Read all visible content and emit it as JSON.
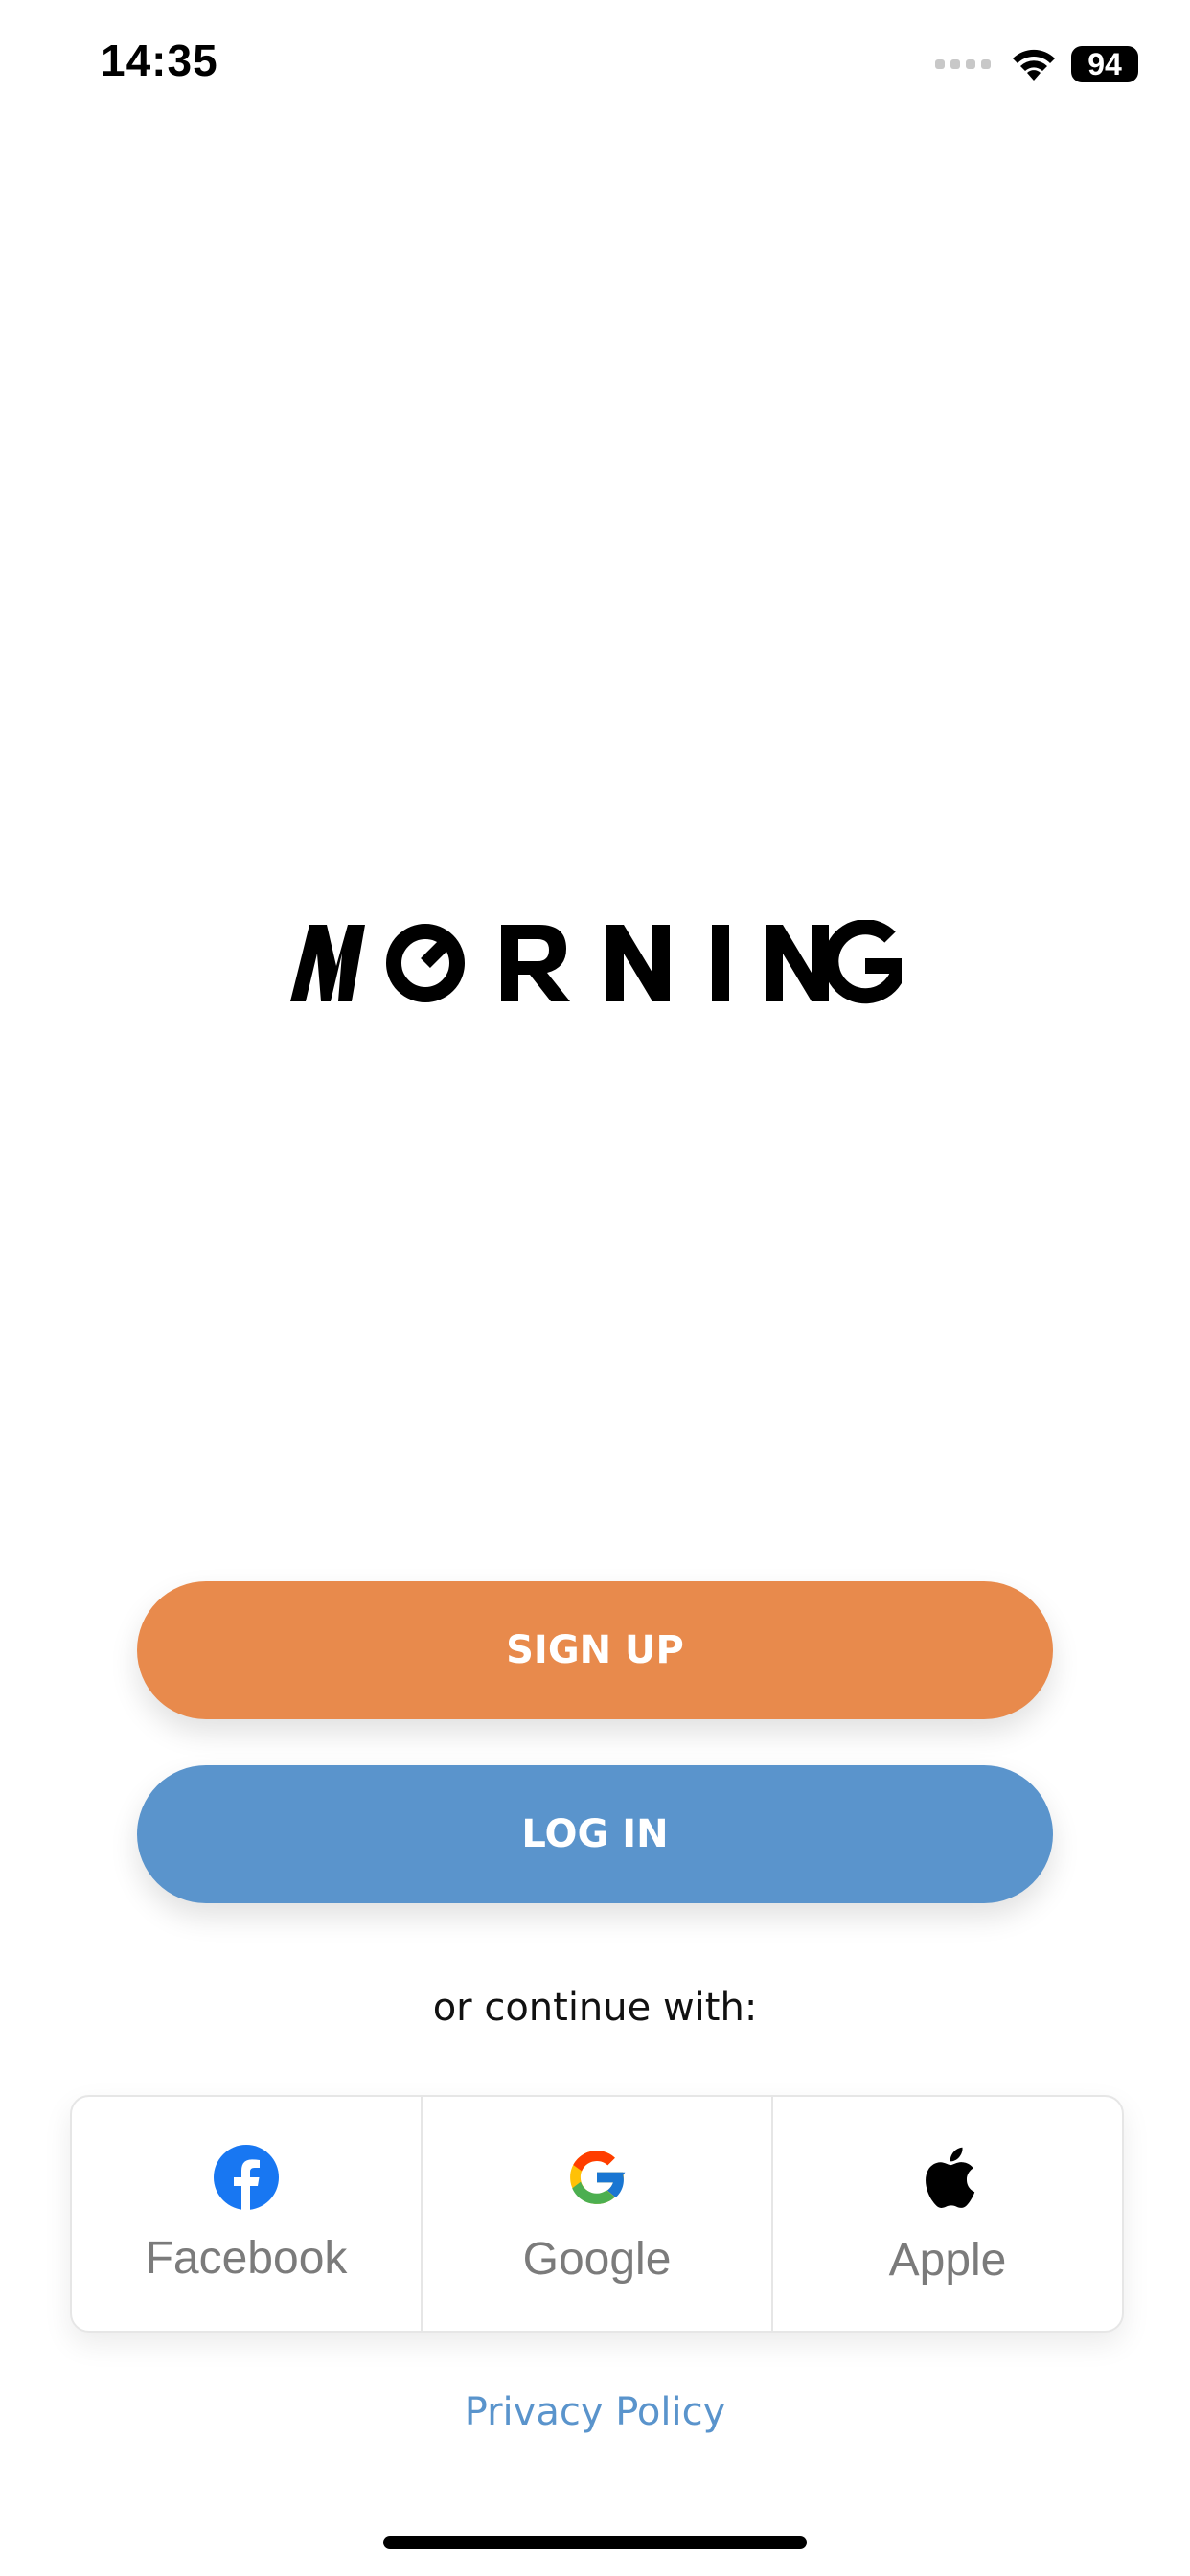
{
  "status_bar": {
    "time": "14:35",
    "battery": "94",
    "icons": [
      "signal-icon",
      "wifi-icon",
      "battery-icon"
    ]
  },
  "logo": {
    "text": "MORNING"
  },
  "actions": {
    "signup_label": "SIGN UP",
    "login_label": "LOG IN"
  },
  "social": {
    "prompt": "or continue with:",
    "providers": [
      {
        "label": "Facebook",
        "icon": "facebook-icon"
      },
      {
        "label": "Google",
        "icon": "google-icon"
      },
      {
        "label": "Apple",
        "icon": "apple-icon"
      }
    ]
  },
  "footer": {
    "privacy_label": "Privacy Policy"
  },
  "colors": {
    "signup": "#e88a4c",
    "login": "#5a94cc",
    "privacy_link": "#5a94cc",
    "facebook": "#1877f2"
  }
}
